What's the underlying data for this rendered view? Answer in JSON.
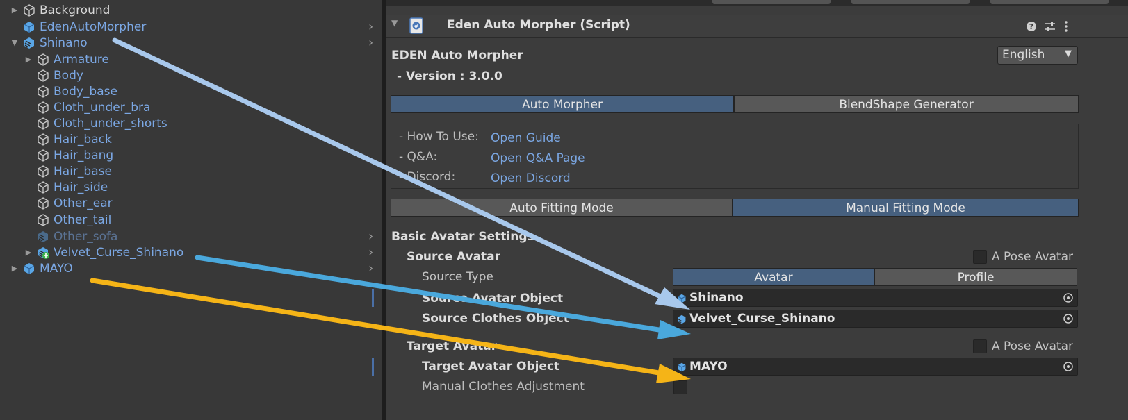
{
  "hierarchy": {
    "items": [
      {
        "label": "Background",
        "color": "white",
        "icon": "cube-outline-icon"
      },
      {
        "label": "EdenAutoMorpher",
        "color": "blue",
        "icon": "prefab-cube-icon"
      },
      {
        "label": "Shinano",
        "color": "blue",
        "icon": "prefab-variant-icon"
      },
      {
        "label": "Armature",
        "color": "blue",
        "icon": "cube-outline-icon"
      },
      {
        "label": "Body",
        "color": "blue",
        "icon": "cube-outline-icon"
      },
      {
        "label": "Body_base",
        "color": "blue",
        "icon": "cube-outline-icon"
      },
      {
        "label": "Cloth_under_bra",
        "color": "blue",
        "icon": "cube-outline-icon"
      },
      {
        "label": "Cloth_under_shorts",
        "color": "blue",
        "icon": "cube-outline-icon"
      },
      {
        "label": "Hair_back",
        "color": "blue",
        "icon": "cube-outline-icon"
      },
      {
        "label": "Hair_bang",
        "color": "blue",
        "icon": "cube-outline-icon"
      },
      {
        "label": "Hair_base",
        "color": "blue",
        "icon": "cube-outline-icon"
      },
      {
        "label": "Hair_side",
        "color": "blue",
        "icon": "cube-outline-icon"
      },
      {
        "label": "Other_ear",
        "color": "blue",
        "icon": "cube-outline-icon"
      },
      {
        "label": "Other_tail",
        "color": "blue",
        "icon": "cube-outline-icon"
      },
      {
        "label": "Other_sofa",
        "color": "dim",
        "icon": "prefab-variant-icon"
      },
      {
        "label": "Velvet_Curse_Shinano",
        "color": "blue",
        "icon": "prefab-added-icon"
      },
      {
        "label": "MAYO",
        "color": "blue",
        "icon": "prefab-cube-icon"
      }
    ]
  },
  "inspector": {
    "component_title": "Eden Auto Morpher (Script)",
    "app_name": "EDEN Auto Morpher",
    "version": "- Version : 3.0.0",
    "language": "English",
    "tabs": [
      "Auto Morpher",
      "BlendShape Generator"
    ],
    "links": [
      {
        "label": "- How To Use:",
        "link": "Open Guide"
      },
      {
        "label": "- Q&A:",
        "link": "Open Q&A Page"
      },
      {
        "label": "- Discord:",
        "link": "Open Discord"
      }
    ],
    "modes": [
      "Auto Fitting Mode",
      "Manual Fitting Mode"
    ],
    "basic_settings": "Basic Avatar Settings",
    "source_avatar": "Source Avatar",
    "a_pose_label": "A Pose Avatar",
    "source_type_label": "Source Type",
    "source_type_options": [
      "Avatar",
      "Profile"
    ],
    "source_avatar_object_label": "Source Avatar Object",
    "source_avatar_object_value": "Shinano",
    "source_clothes_label": "Source Clothes Object",
    "source_clothes_value": "Velvet_Curse_Shinano",
    "target_avatar": "Target Avatar",
    "target_avatar_object_label": "Target Avatar Object",
    "target_avatar_object_value": "MAYO",
    "manual_clothes_label": "Manual Clothes Adjustment"
  },
  "colors": {
    "accent_blue": "#46607f",
    "link_blue": "#7ba7e3",
    "arrow_light_blue": "#a8c8ec",
    "arrow_blue": "#4aa8dc",
    "arrow_yellow": "#f5b417"
  }
}
